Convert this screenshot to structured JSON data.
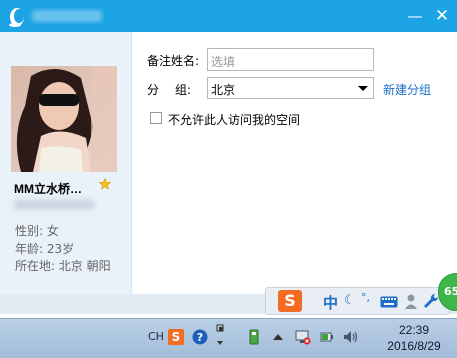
{
  "window": {
    "minimize_icon": "minimize-icon",
    "close_icon": "close-icon",
    "logo_icon": "qq-penguin-icon"
  },
  "profile": {
    "nickname": "MM立水桥…",
    "gender": "性别: 女",
    "age": "年龄: 23岁",
    "location": "所在地: 北京  朝阳"
  },
  "form": {
    "remark_label": "备注姓名:",
    "remark_placeholder": "选填",
    "group_label_a": "分",
    "group_label_b": "组:",
    "group_value": "北京",
    "new_group_link": "新建分组",
    "block_space_label": "不允许此人访问我的空间"
  },
  "ime": {
    "logo": "S",
    "lang": "中"
  },
  "badge": "65",
  "taskbar": {
    "lang_code": "CH",
    "time": "22:39",
    "date": "2016/8/29"
  },
  "colors": {
    "titlebar": "#1ba3e4",
    "link": "#1a6fc9"
  }
}
